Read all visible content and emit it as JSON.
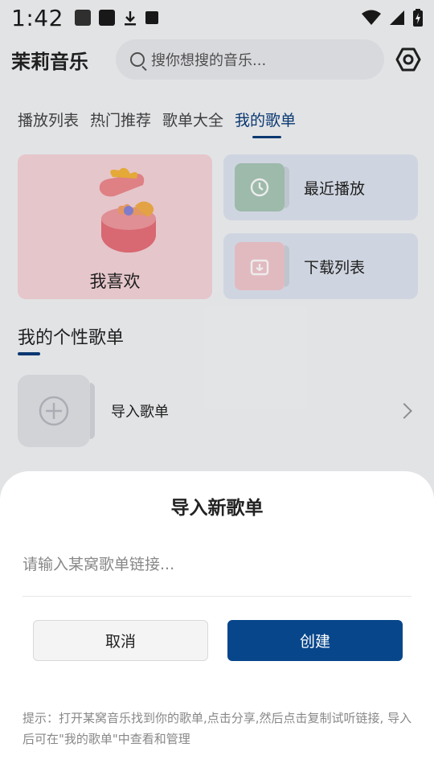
{
  "status_bar": {
    "time": "1:42"
  },
  "header": {
    "app_title": "茉莉音乐",
    "search_placeholder": "搜你想搜的音乐..."
  },
  "tabs": [
    {
      "label": "播放列表",
      "active": false
    },
    {
      "label": "热门推荐",
      "active": false
    },
    {
      "label": "歌单大全",
      "active": false
    },
    {
      "label": "我的歌单",
      "active": true
    }
  ],
  "cards": {
    "like": "我喜欢",
    "recent": "最近播放",
    "download": "下载列表"
  },
  "section": {
    "title": "我的个性歌单",
    "import_label": "导入歌单"
  },
  "dialog": {
    "title": "导入新歌单",
    "input_placeholder": "请输入某窝歌单链接...",
    "input_value": "",
    "cancel_label": "取消",
    "create_label": "创建",
    "hint": "提示：打开某窝音乐找到你的歌单,点击分享,然后点击复制试听链接, 导入后可在\"我的歌单\"中查看和管理"
  },
  "colors": {
    "accent": "#07468b",
    "tab_active": "#0b3d7a",
    "like_card_bg": "#f7d6db",
    "mini_card_bg": "#dfe6f1"
  }
}
